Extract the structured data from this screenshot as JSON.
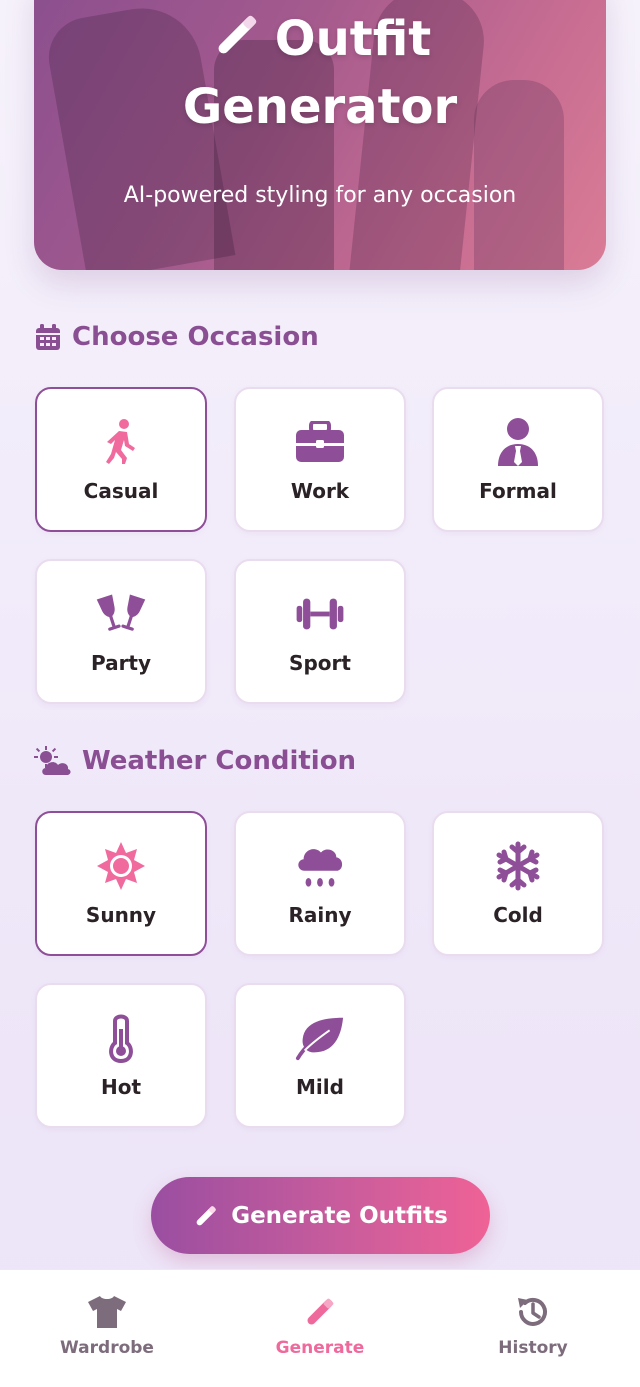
{
  "hero": {
    "title_line1": "Outfit",
    "title_line2": "Generator",
    "subtitle": "AI-powered styling for any occasion"
  },
  "occasion": {
    "heading": "Choose Occasion",
    "icon": "calendar-icon",
    "selected": "Casual",
    "items": [
      {
        "label": "Casual",
        "icon": "walking-icon"
      },
      {
        "label": "Work",
        "icon": "briefcase-icon"
      },
      {
        "label": "Formal",
        "icon": "user-tie-icon"
      },
      {
        "label": "Party",
        "icon": "glasses-cheers-icon"
      },
      {
        "label": "Sport",
        "icon": "dumbbell-icon"
      }
    ]
  },
  "weather": {
    "heading": "Weather Condition",
    "icon": "cloud-sun-icon",
    "selected": "Sunny",
    "items": [
      {
        "label": "Sunny",
        "icon": "sun-icon"
      },
      {
        "label": "Rainy",
        "icon": "cloud-rain-icon"
      },
      {
        "label": "Cold",
        "icon": "snowflake-icon"
      },
      {
        "label": "Hot",
        "icon": "thermometer-icon"
      },
      {
        "label": "Mild",
        "icon": "leaf-icon"
      }
    ]
  },
  "generate_button": {
    "label": "Generate Outfits",
    "icon": "magic-wand-icon"
  },
  "bottom_nav": {
    "active": "Generate",
    "items": [
      {
        "label": "Wardrobe",
        "icon": "tshirt-icon"
      },
      {
        "label": "Generate",
        "icon": "magic-wand-icon"
      },
      {
        "label": "History",
        "icon": "history-icon"
      }
    ]
  },
  "colors": {
    "accent_purple": "#8a4f93",
    "accent_pink": "#ef6a9c",
    "selected_icon": "#f06a9e",
    "icon_purple": "#8e4f98"
  }
}
